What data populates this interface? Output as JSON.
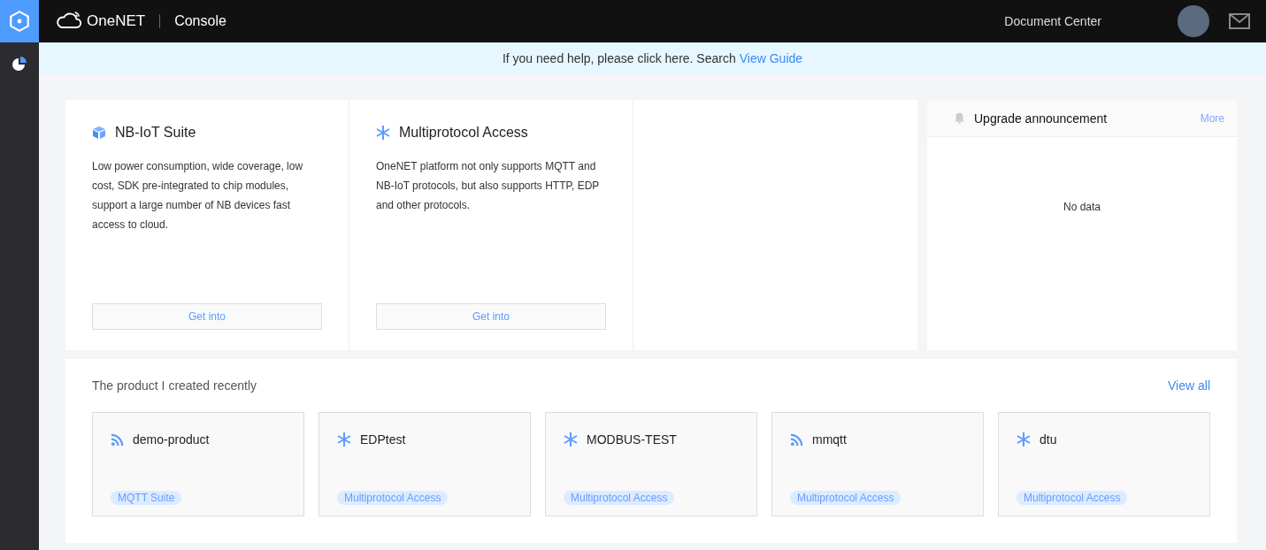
{
  "sidebar": {
    "items": [
      {
        "kind": "hexagon",
        "selected": true
      },
      {
        "kind": "pie",
        "selected": false
      }
    ]
  },
  "header": {
    "brand": "OneNET",
    "title": "Console",
    "links": [
      "Document Center"
    ]
  },
  "help_banner": {
    "text": "If you need help, please click here. Search",
    "link": "View Guide"
  },
  "suites": [
    {
      "kind": "cube",
      "title": "NB-IoT Suite",
      "description": "Low power consumption, wide coverage, low cost, SDK pre-integrated to chip modules, support a large number of NB devices fast access to cloud.",
      "button": "Get into"
    },
    {
      "kind": "asterisk",
      "title": "Multiprotocol Access",
      "description": "OneNET platform not only supports MQTT and NB-IoT protocols, but also supports HTTP, EDP and other protocols.",
      "button": "Get into"
    }
  ],
  "announcement": {
    "title": "Upgrade announcement",
    "more": "More",
    "empty": "No data"
  },
  "recent": {
    "title": "The product I created recently",
    "view_all": "View all",
    "products": [
      {
        "kind": "mqtt",
        "name": "demo-product",
        "tag": "MQTT Suite"
      },
      {
        "kind": "multiprotocol",
        "name": "EDPtest",
        "tag": "Multiprotocol Access"
      },
      {
        "kind": "multiprotocol",
        "name": "MODBUS-TEST",
        "tag": "Multiprotocol Access"
      },
      {
        "kind": "mqtt",
        "name": "mmqtt",
        "tag": "Multiprotocol Access"
      },
      {
        "kind": "multiprotocol",
        "name": "dtu",
        "tag": "Multiprotocol Access"
      }
    ]
  }
}
